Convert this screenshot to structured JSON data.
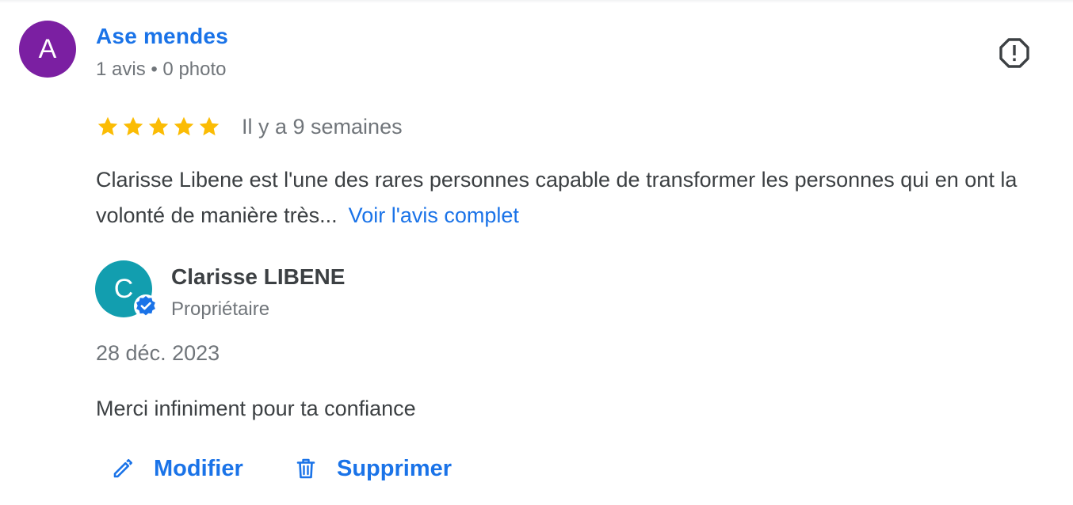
{
  "review": {
    "author": {
      "initial": "A",
      "name": "Ase mendes",
      "meta": "1 avis • 0 photo",
      "avatar_color": "#7b1fa2"
    },
    "rating": 5,
    "time": "Il y a 9 semaines",
    "text": "Clarisse Libene est l'une des rares personnes capable de transformer les personnes qui en ont la volonté de manière très...",
    "more_label": "Voir l'avis complet",
    "report_icon": "report-icon"
  },
  "reply": {
    "owner": {
      "initial": "C",
      "name": "Clarisse LIBENE",
      "role": "Propriétaire",
      "avatar_color": "#129eaf",
      "badge_icon": "verified-icon"
    },
    "date": "28 déc. 2023",
    "text": "Merci infiniment pour ta confiance"
  },
  "actions": {
    "edit_label": "Modifier",
    "edit_icon": "pencil-icon",
    "delete_label": "Supprimer",
    "delete_icon": "trash-icon"
  },
  "colors": {
    "link": "#1a73e8",
    "star": "#fbbc04",
    "text": "#3c4043",
    "secondary": "#70757a"
  }
}
